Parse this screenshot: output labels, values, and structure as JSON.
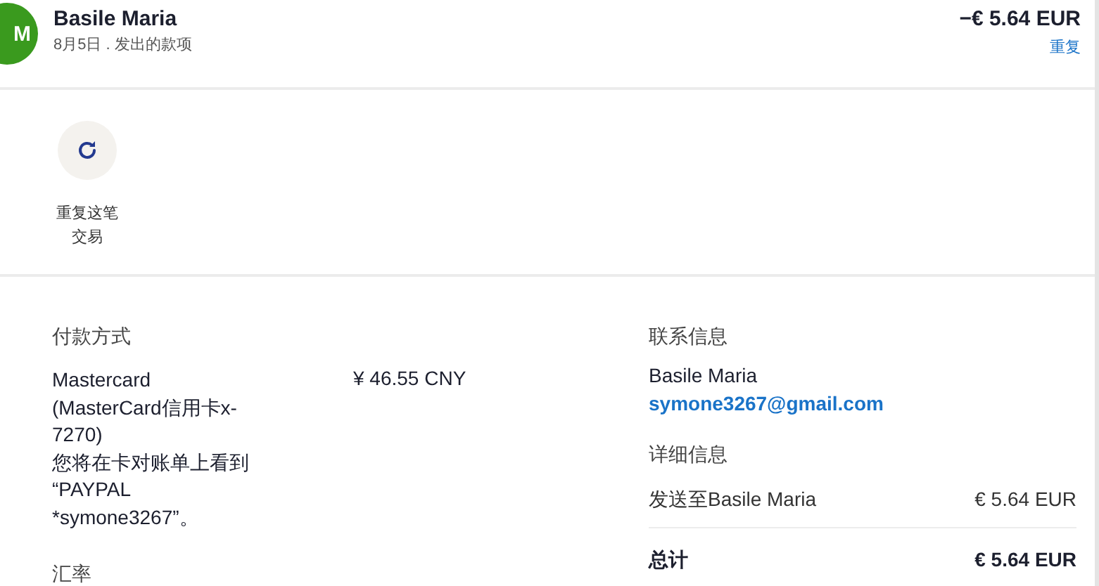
{
  "header": {
    "avatar_initials": "M",
    "name": "Basile Maria",
    "subtitle": "8月5日 . 发出的款项",
    "amount": "−€ 5.64 EUR",
    "action_link": "重复"
  },
  "actions": [
    {
      "label": "重复这笔交易",
      "kind": "repeat"
    }
  ],
  "payment": {
    "heading": "付款方式",
    "method": "Mastercard\n(MasterCard信用卡x-\n7270)\n您将在卡对账单上看到\n“PAYPAL\n*symone3267”。",
    "amount": "¥ 46.55 CNY",
    "next_heading": "汇率"
  },
  "contact": {
    "heading": "联系信息",
    "name": "Basile Maria",
    "email": "symone3267@gmail.com"
  },
  "details": {
    "heading": "详细信息",
    "rows": [
      {
        "label": "发送至Basile Maria",
        "value": "€ 5.64 EUR",
        "kind": "line"
      },
      {
        "label": "总计",
        "value": "€ 5.64 EUR",
        "kind": "total"
      }
    ]
  }
}
